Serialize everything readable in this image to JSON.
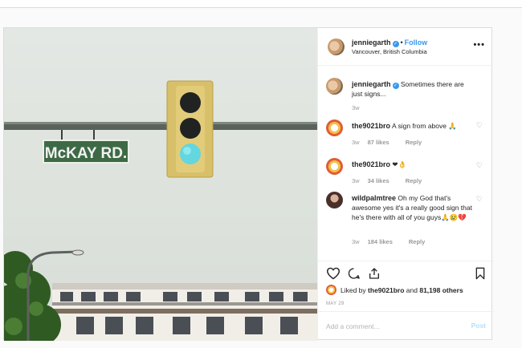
{
  "header": {
    "username": "jenniegarth",
    "separator": "•",
    "follow_label": "Follow",
    "location": "Vancouver, British Columbia",
    "more_label": "•••"
  },
  "photo": {
    "street_sign": "McKAY RD."
  },
  "comments": [
    {
      "username": "jenniegarth",
      "text": "Sometimes there are just signs...",
      "time": "3w",
      "likes": "",
      "reply": "",
      "verified": true
    },
    {
      "username": "the9021bro",
      "text": "A sign from above 🙏",
      "time": "3w",
      "likes": "87 likes",
      "reply": "Reply"
    },
    {
      "username": "the9021bro",
      "text": "❤👌",
      "time": "3w",
      "likes": "34 likes",
      "reply": "Reply"
    },
    {
      "username": "wildpalmtree",
      "text": "Oh my God that's awesome yes it's a really good sign that he's there with all of you guys🙏😢💔",
      "time": "3w",
      "likes": "184 likes",
      "reply": "Reply"
    }
  ],
  "likes": {
    "prefix": "Liked by",
    "user": "the9021bro",
    "joiner": "and",
    "others": "81,198 others"
  },
  "date": "MAY 29",
  "add_comment": {
    "placeholder": "Add a comment...",
    "post_label": "Post"
  },
  "colors": {
    "link_blue": "#3897f0",
    "post_disabled": "#b2dffc",
    "meta_grey": "#999999",
    "border": "#dbdbdb"
  },
  "icons": [
    "verified-badge-icon",
    "more-icon",
    "heart-icon",
    "comment-icon",
    "share-icon",
    "bookmark-icon"
  ]
}
